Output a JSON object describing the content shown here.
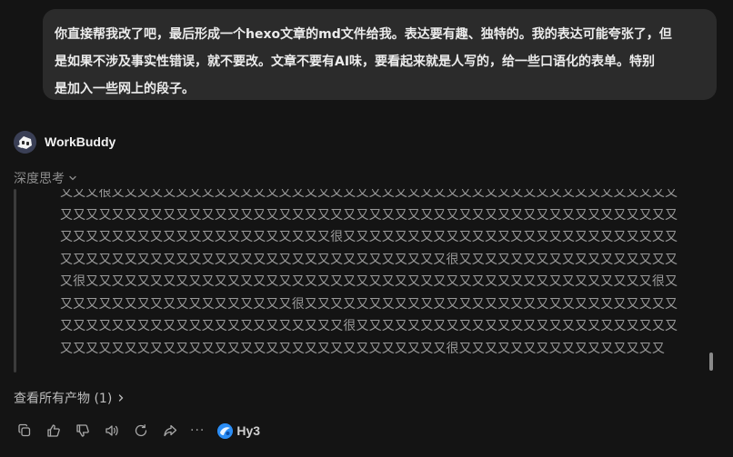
{
  "user_message": {
    "lines": [
      "你直接帮我改了吧，最后形成一个hexo文章的md文件给我。表达要有趣、独特的。我的表达可能夸张了，但",
      "是如果不涉及事实性错误，就不要改。文章不要有AI味，要看起来就是人写的，给一些口语化的表单。特别",
      "是加入一些网上的段子。"
    ]
  },
  "assistant": {
    "name": "WorkBuddy",
    "avatar_icon": "workbuddy-robot-icon"
  },
  "thinking": {
    "toggle_label": "深度思考",
    "lines": [
      "又又又很又又又又又又又又又又又又又又又又又又又又又又又又又又又又又又又又又又又又又又又又又又又又",
      "又又又又又又又又又又又又又又又又又又又又又又又又又又又又又又又又又又又又又又又又又又又又又又又又",
      "又又又又又又又又又又又又又又又又又又又又又很又又又又又又又又又又又又又又又又又又又又又又又又又又",
      "又又又又又又又又又又又又又又又又又又又又又又又又又又又又又又很又又又又又又又又又又又又又又又又又",
      "又很又又又又又又又又又又又又又又又又又又又又又又又又又又又又又又又又又又又又又又又又又又又又很又",
      "又又又又又又又又又又又又又又又又又又很又又又又又又又又又又又又又又又又又又又又又又又又又又又又又",
      "又又又又又又又又又又又又又又又又又又又又又又很又又又又又又又又又又又又又又又又又又又又又又又又又",
      "又又又又又又又又又又又又又又又又又又又又又又又又又又又又又又很又又又又又又又又又又又又又又又又"
    ]
  },
  "artifacts": {
    "label": "查看所有产物 (1)"
  },
  "toolbar": {
    "actions": [
      "copy-icon",
      "thumbs-up-icon",
      "thumbs-down-icon",
      "speaker-icon",
      "refresh-icon",
      "share-icon"
    ],
    "more_label": "···",
    "model_name": "Hy3",
    "model_icon": "hunyuan-logo-icon"
  },
  "colors": {
    "background": "#141414",
    "bubble": "#2b2b2b",
    "muted_text": "#8e8e8e",
    "model_logo": "#2b8df5"
  }
}
